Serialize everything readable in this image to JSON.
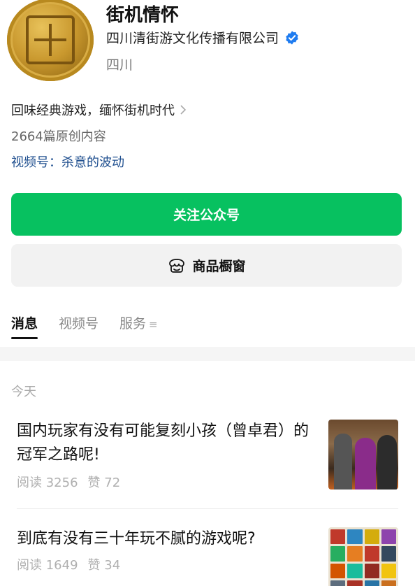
{
  "profile": {
    "name": "街机情怀",
    "company": "四川清街游文化传播有限公司",
    "region": "四川",
    "slogan": "回味经典游戏，缅怀街机时代",
    "original_count": "2664篇原创内容",
    "video_channel": "视频号：杀意的波动"
  },
  "actions": {
    "follow_label": "关注公众号",
    "shop_label": "商品橱窗"
  },
  "tabs": [
    "消息",
    "视频号",
    "服务"
  ],
  "feed": {
    "day_label": "今天",
    "articles": [
      {
        "title": "国内玩家有没有可能复刻小孩（曾卓君）的冠军之路呢!",
        "reads": "阅读 3256",
        "likes": "赞 72"
      },
      {
        "title": "到底有没有三十年玩不腻的游戏呢?",
        "reads": "阅读 1649",
        "likes": "赞 34"
      }
    ]
  },
  "icons": {
    "verified": "verified-badge-icon",
    "chevron": "chevron-right-icon",
    "shop": "shop-window-icon",
    "menu": "menu-icon"
  },
  "colors": {
    "accent": "#07c160",
    "link": "#1f4f8f",
    "verified": "#1f7cf0"
  }
}
